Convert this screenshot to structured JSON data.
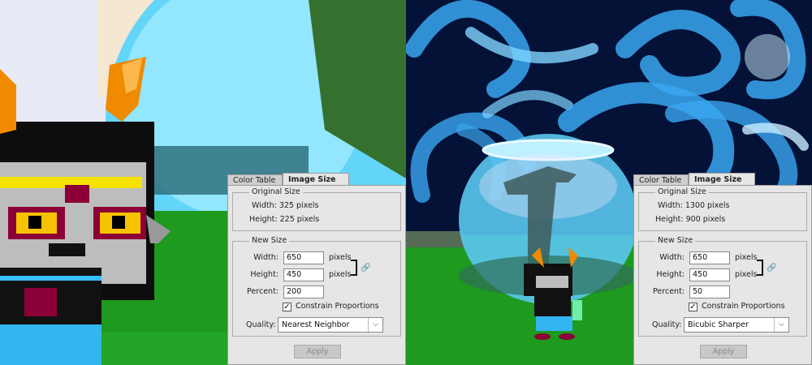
{
  "panels": [
    {
      "tabs": {
        "color_table": "Color Table",
        "image_size": "Image Size"
      },
      "original": {
        "title": "Original Size",
        "width_text": "Width: 325 pixels",
        "height_text": "Height: 225 pixels"
      },
      "new_size": {
        "title": "New Size",
        "width_label": "Width:",
        "width_value": "650",
        "width_unit": "pixels",
        "height_label": "Height:",
        "height_value": "450",
        "height_unit": "pixels",
        "percent_label": "Percent:",
        "percent_value": "200",
        "constrain_label": "Constrain Proportions",
        "quality_label": "Quality:",
        "quality_value": "Nearest Neighbor"
      },
      "apply_label": "Apply"
    },
    {
      "tabs": {
        "color_table": "Color Table",
        "image_size": "Image Size"
      },
      "original": {
        "title": "Original Size",
        "width_text": "Width: 1300 pixels",
        "height_text": "Height: 900 pixels"
      },
      "new_size": {
        "title": "New Size",
        "width_label": "Width:",
        "width_value": "650",
        "width_unit": "pixels",
        "height_label": "Height:",
        "height_value": "450",
        "height_unit": "pixels",
        "percent_label": "Percent:",
        "percent_value": "50",
        "constrain_label": "Constrain Proportions",
        "quality_label": "Quality:",
        "quality_value": "Bicubic Sharper"
      },
      "apply_label": "Apply"
    }
  ],
  "icons": {
    "link": "chain-link-icon",
    "check": "checkmark-icon",
    "dropdown": "chevron-down-icon"
  },
  "colors": {
    "panel_bg": "#e6e6e6",
    "grass": "#1e9a1e",
    "water": "#5fd0f5",
    "dark_blue": "#041238"
  }
}
